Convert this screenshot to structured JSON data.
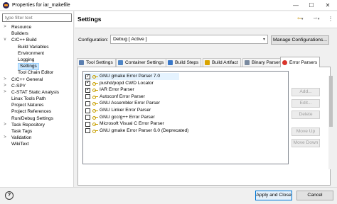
{
  "window": {
    "title": "Properties for iar_makefile",
    "minimize": "—",
    "maximize": "☐",
    "close": "✕"
  },
  "filter": {
    "placeholder": "type filter text"
  },
  "tree": [
    {
      "label": "Resource",
      "twisty": ">",
      "level": 0
    },
    {
      "label": "Builders",
      "twisty": "",
      "level": 0
    },
    {
      "label": "C/C++ Build",
      "twisty": "v",
      "level": 0
    },
    {
      "label": "Build Variables",
      "twisty": "",
      "level": 1
    },
    {
      "label": "Environment",
      "twisty": "",
      "level": 1
    },
    {
      "label": "Logging",
      "twisty": "",
      "level": 1
    },
    {
      "label": "Settings",
      "twisty": "",
      "level": 1,
      "selected": true
    },
    {
      "label": "Tool Chain Editor",
      "twisty": "",
      "level": 1
    },
    {
      "label": "C/C++ General",
      "twisty": ">",
      "level": 0
    },
    {
      "label": "C-SPY",
      "twisty": ">",
      "level": 0
    },
    {
      "label": "C-STAT Static Analysis",
      "twisty": ">",
      "level": 0
    },
    {
      "label": "Linux Tools Path",
      "twisty": "",
      "level": 0
    },
    {
      "label": "Project Natures",
      "twisty": "",
      "level": 0
    },
    {
      "label": "Project References",
      "twisty": "",
      "level": 0
    },
    {
      "label": "Run/Debug Settings",
      "twisty": "",
      "level": 0
    },
    {
      "label": "Task Repository",
      "twisty": ">",
      "level": 0
    },
    {
      "label": "Task Tags",
      "twisty": "",
      "level": 0
    },
    {
      "label": "Validation",
      "twisty": ">",
      "level": 0
    },
    {
      "label": "WikiText",
      "twisty": "",
      "level": 0
    }
  ],
  "header": {
    "title": "Settings",
    "back": "⇦",
    "forward": "⇨",
    "dropdown": "▾",
    "more": "⋮"
  },
  "configuration": {
    "label": "Configuration:",
    "value": "Debug  [ Active ]",
    "arrow": "▾",
    "manage_label": "Manage Configurations..."
  },
  "tabs": [
    {
      "label": "Tool Settings",
      "icon": "tool-settings-icon",
      "color": "#5b7fb0"
    },
    {
      "label": "Container Settings",
      "icon": "container-settings-icon",
      "color": "#4f86c6"
    },
    {
      "label": "Build Steps",
      "icon": "build-steps-icon",
      "color": "#3a78c8"
    },
    {
      "label": "Build Artifact",
      "icon": "build-artifact-icon",
      "color": "#d9a400"
    },
    {
      "label": "Binary Parsers",
      "icon": "binary-parsers-icon",
      "color": "#7a8aa0"
    },
    {
      "label": "Error Parsers",
      "icon": "error-parsers-icon",
      "color": "#d9342b",
      "active": true
    }
  ],
  "parsers": [
    {
      "label": "GNU gmake Error Parser 7.0",
      "checked": true,
      "selected": true
    },
    {
      "label": "pushd/popd CWD Locator",
      "checked": true
    },
    {
      "label": "IAR Error Parser",
      "checked": true
    },
    {
      "label": "Autoconf Error Parser",
      "checked": false
    },
    {
      "label": "GNU Assembler Error Parser",
      "checked": false
    },
    {
      "label": "GNU Linker Error Parser",
      "checked": false
    },
    {
      "label": "GNU gcc/g++ Error Parser",
      "checked": false
    },
    {
      "label": "Microsoft Visual C Error Parser",
      "checked": false
    },
    {
      "label": "GNU gmake Error Parser 6.0 (Deprecated)",
      "checked": false
    }
  ],
  "side_buttons": {
    "add": "Add...",
    "edit": "Edit...",
    "delete": "Delete",
    "move_up": "Move Up",
    "move_down": "Move Down"
  },
  "footer": {
    "help": "?",
    "apply_close": "Apply and Close",
    "cancel": "Cancel"
  }
}
